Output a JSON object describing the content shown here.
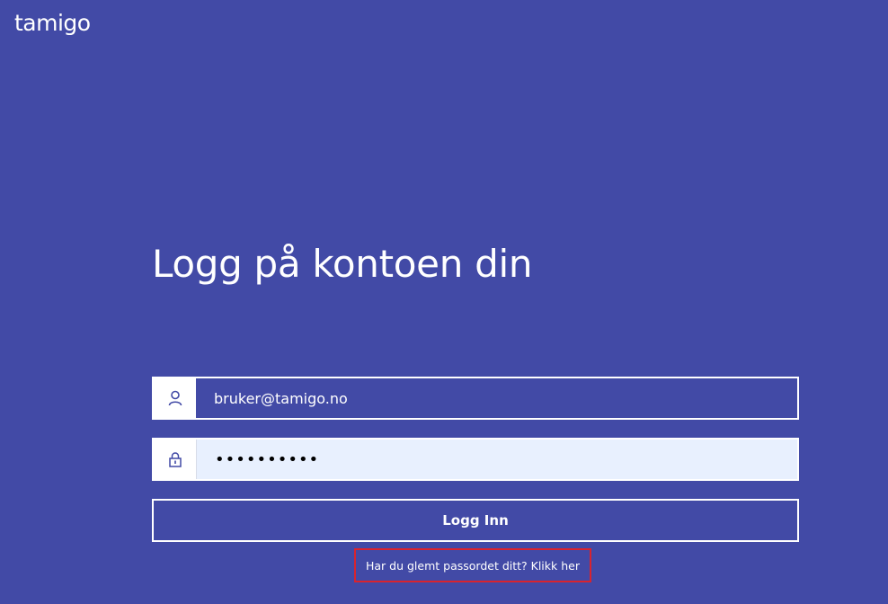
{
  "header": {
    "logo_text": "tamigo"
  },
  "main": {
    "title": "Logg på kontoen din",
    "email_field": {
      "icon": "user-icon",
      "value": "bruker@tamigo.no"
    },
    "password_field": {
      "icon": "lock-icon",
      "value": "••••••••••"
    },
    "login_button_label": "Logg Inn",
    "forgot_password_link": "Har du glemt passordet ditt? Klikk her"
  },
  "colors": {
    "background": "#424aa6",
    "foreground": "#ffffff",
    "autofill_background": "#e8f0fe",
    "highlight_border": "#d9232e"
  }
}
